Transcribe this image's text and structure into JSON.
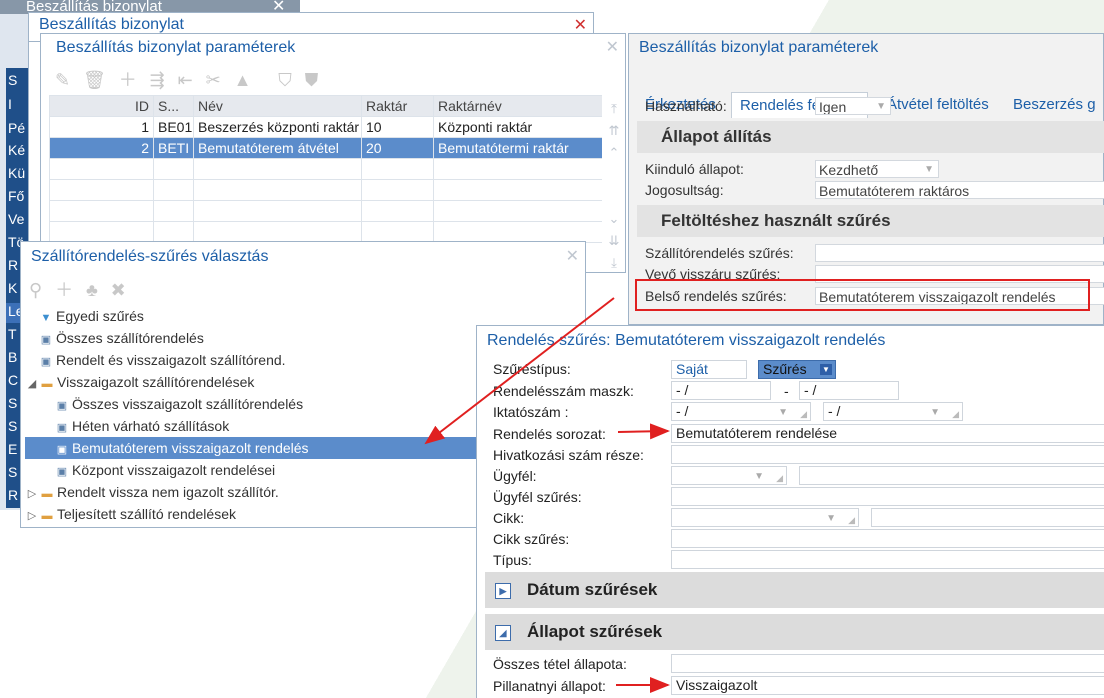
{
  "back_window": {
    "title": "Beszállítás bizonylat"
  },
  "left_strip": {
    "labels": [
      "S",
      "I",
      "Pé",
      "Ké",
      "Kü",
      "Fő",
      "Ve",
      "Tö",
      "R",
      "K",
      "Le",
      "T",
      "B",
      "C",
      "S",
      "S",
      "E",
      "S",
      "R"
    ]
  },
  "main_window": {
    "title": "Beszállítás bizonylat"
  },
  "list_window": {
    "title": "Beszállítás bizonylat paraméterek",
    "columns": [
      "ID",
      "S...",
      "Név",
      "Raktár",
      "Raktárnév"
    ],
    "rows": [
      [
        "1",
        "BE01",
        "Beszerzés központi raktár",
        "10",
        "Központi raktár"
      ],
      [
        "2",
        "BETI",
        "Bemutatóterem átvétel",
        "20",
        "Bemutatótermi raktár"
      ]
    ]
  },
  "params_window": {
    "title": "Beszállítás bizonylat paraméterek",
    "tabs": [
      "Érkeztetés",
      "Rendelés feltöltés",
      "Átvétel feltöltés",
      "Beszerzés g"
    ],
    "hasznalhato_label": "Használható:",
    "hasznalhato_value": "Igen",
    "section1": "Állapot állítás",
    "kiindulo_label": "Kiinduló állapot:",
    "kiindulo_value": "Kezdhető",
    "jogosultsag_label": "Jogosultság:",
    "jogosultsag_value": "Bemutatóterem raktáros",
    "section2": "Feltöltéshez használt szűrés",
    "szallito_label": "Szállítórendelés szűrés:",
    "vevo_label": "Vevő visszáru szűrés:",
    "belso_label": "Belső rendelés szűrés:",
    "belso_value": "Bemutatóterem visszaigazolt rendelés"
  },
  "tree_window": {
    "title": "Szállítórendelés-szűrés választás",
    "items": [
      "Egyedi szűrés",
      "Összes szállítórendelés",
      "Rendelt és visszaigazolt szállítórend.",
      "Visszaigazolt szállítórendelések",
      "Összes visszaigazolt szállítórendelés",
      "Héten várható szállítások",
      "Bemutatóterem visszaigazolt rendelés",
      "Központ visszaigazolt rendelései",
      "Rendelt vissza nem igazolt szállítór.",
      "Teljesített szállító rendelések"
    ]
  },
  "filter_window": {
    "title": "Rendelés szűrés: Bemutatóterem visszaigazolt rendelés",
    "szurestipus_label": "Szűréstípus:",
    "szurestipus_opt1": "Saját",
    "szurestipus_opt2": "Szűrés",
    "maszk_label": "Rendelésszám maszk:",
    "maszk_from": " -  /",
    "maszk_to": " -  /",
    "dash": "-",
    "iktato_label": "Iktatószám :",
    "iktato_from": " -  /",
    "iktato_to": " -  /",
    "sorozat_label": "Rendelés sorozat:",
    "sorozat_value": "Bemutatóterem rendelése",
    "hivatkozasi_label": "Hivatkozási szám része:",
    "ugyfel_label": "Ügyfél:",
    "ugyfel_szures_label": "Ügyfél szűrés:",
    "cikk_label": "Cikk:",
    "cikk_szures_label": "Cikk szűrés:",
    "tipus_label": "Típus:",
    "datum_section": "Dátum szűrések",
    "allapot_section": "Állapot szűrések",
    "osszes_tetel_label": "Összes tétel állapota:",
    "pillanatnyi_label": "Pillanatnyi állapot:",
    "pillanatnyi_value": "Visszaigazolt"
  }
}
